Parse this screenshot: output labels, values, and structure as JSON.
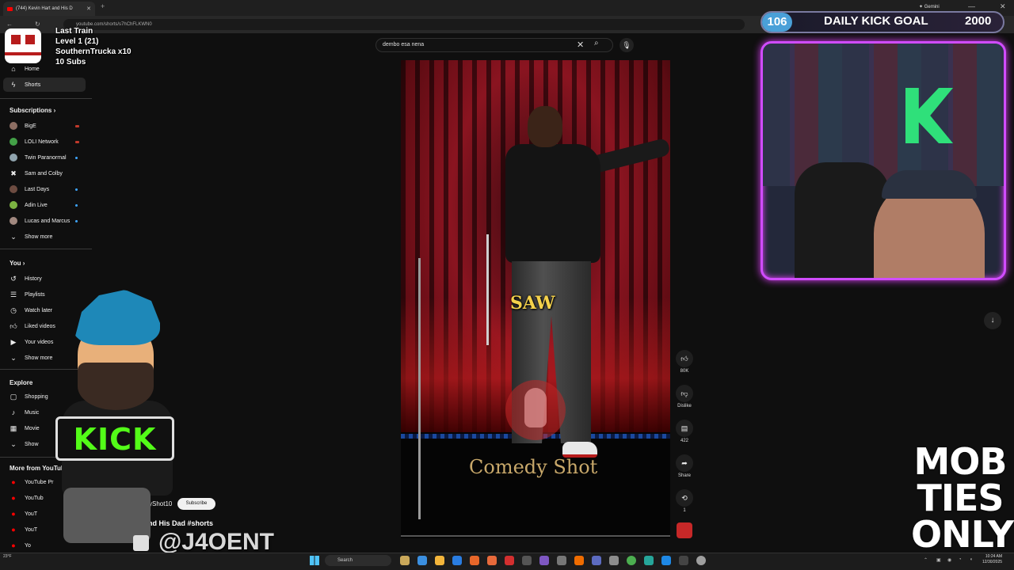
{
  "browser": {
    "tab_title": "(744) Kevin Hart and His D",
    "url": "youtube.com/shorts/s7hChFLKWN0",
    "gemini_label": "Gemini"
  },
  "search": {
    "query": "dembo esa nena"
  },
  "sidebar": {
    "logo": "YouTube",
    "home": "Home",
    "shorts": "Shorts",
    "subscriptions_header": "Subscriptions",
    "subscriptions": [
      {
        "label": "BigE",
        "color": "#8d6e63",
        "live": true
      },
      {
        "label": "LOLI Network",
        "color": "#43a047",
        "live": true
      },
      {
        "label": "Twin Paranormal",
        "color": "#90a4ae",
        "live": false
      },
      {
        "label": "Sam and Colby",
        "color": "#111111",
        "live": false
      },
      {
        "label": "Last Days",
        "color": "#6d4c41",
        "live": false
      },
      {
        "label": "Adin Live",
        "color": "#7cb342",
        "live": false
      },
      {
        "label": "Lucas and Marcus",
        "color": "#a1887f",
        "live": false
      }
    ],
    "show_more": "Show more",
    "you_header": "You",
    "you_items": [
      "History",
      "Playlists",
      "Watch later",
      "Liked videos",
      "Your videos"
    ],
    "you_show_more": "Show more",
    "explore_header": "Explore",
    "explore_items": [
      "Shopping",
      "Music",
      "Movie",
      "Show"
    ],
    "more_header": "More from YouTube",
    "more_items": [
      "YouTube Pr",
      "YouTub",
      "YouT",
      "YouT",
      "Yo"
    ]
  },
  "video": {
    "caption": "SAW",
    "watermark": "Comedy Shot",
    "channel": "omedyShot10",
    "subscribe": "Subscribe",
    "title": "art and His Dad #shorts"
  },
  "actions": {
    "likes": "80K",
    "dislike": "Dislike",
    "comments": "422",
    "share": "Share",
    "remix": "1"
  },
  "overlay": {
    "train_title": "Last Train",
    "train_level": "Level 1  (21)",
    "train_user": "SouthernTrucka x10",
    "train_subs": "10 Subs",
    "kick_sign": "KICK",
    "handle": "@J4OENT",
    "goal_current": "106",
    "goal_title": "DAILY KICK GOAL",
    "goal_target": "2000",
    "mob_lines": [
      "MOB",
      "TIES",
      "ONLY"
    ]
  },
  "taskbar": {
    "search": "Search",
    "time": "10:24 AM",
    "date": "12/30/2025",
    "weather": "23°F"
  },
  "colors": {
    "kick_green": "#53fc18",
    "neon_frame": "#d04cff",
    "caption_yellow": "#f5d24b"
  }
}
